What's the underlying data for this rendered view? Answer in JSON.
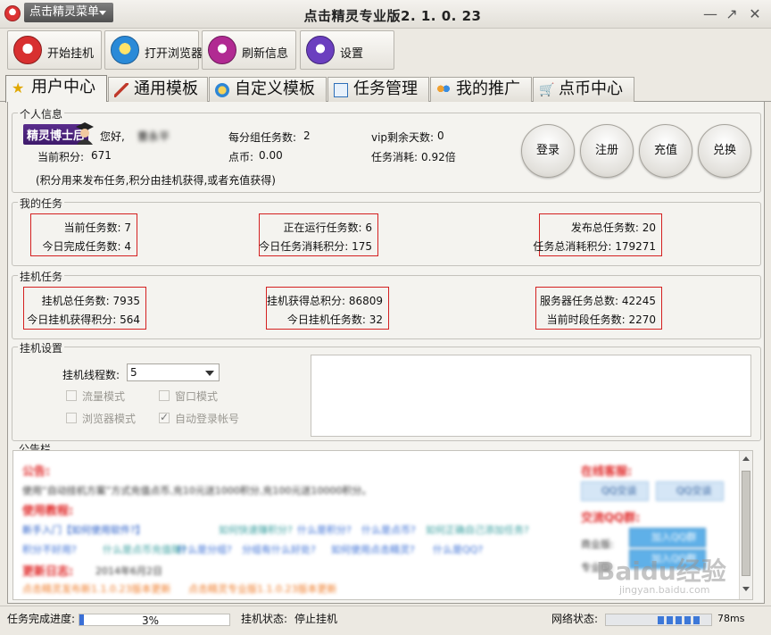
{
  "titlebar": {
    "menu_button": "点击精灵菜单",
    "title": "点击精灵专业版2. 1. 0. 23",
    "minimize": "—",
    "restore": "↗",
    "close": "✕"
  },
  "toolbar": {
    "buttons": [
      {
        "label": "开始挂机",
        "icon": "start-hook-icon"
      },
      {
        "label": "打开浏览器",
        "icon": "browser-icon"
      },
      {
        "label": "刷新信息",
        "icon": "refresh-icon"
      },
      {
        "label": "设置",
        "icon": "settings-icon"
      }
    ]
  },
  "tabs": [
    {
      "label": "用户中心",
      "icon": "star-icon",
      "active": true
    },
    {
      "label": "通用模板",
      "icon": "brush-icon"
    },
    {
      "label": "自定义模板",
      "icon": "globe-icon"
    },
    {
      "label": "任务管理",
      "icon": "task-icon"
    },
    {
      "label": "我的推广",
      "icon": "people-icon"
    },
    {
      "label": "点币中心",
      "icon": "cart-icon"
    }
  ],
  "user_info": {
    "group_title": "个人信息",
    "badge": "精灵博士后",
    "greeting": "您好,",
    "username": "曹永平",
    "tasks_per_group_label": "每分组任务数:",
    "tasks_per_group": "2",
    "vip_days_label": "vip剩余天数:",
    "vip_days": "0",
    "points_label": "当前积分:",
    "points": "671",
    "coins_label": "点币:",
    "coins": "0.00",
    "task_cost_label": "任务消耗:",
    "task_cost": "0.92倍",
    "note": "(积分用来发布任务,积分由挂机获得,或者充值获得)",
    "buttons": [
      "登录",
      "注册",
      "充值",
      "兑换"
    ]
  },
  "my_tasks": {
    "group_title": "我的任务",
    "current_tasks_label": "当前任务数:",
    "current_tasks": "7",
    "today_completed_label": "今日完成任务数:",
    "today_completed": "4",
    "running_tasks_label": "正在运行任务数:",
    "running_tasks": "6",
    "today_points_used_label": "今日任务消耗积分:",
    "today_points_used": "175",
    "published_total_label": "发布总任务数:",
    "published_total": "20",
    "total_points_used_label": "任务总消耗积分:",
    "total_points_used": "179271"
  },
  "hook_tasks": {
    "group_title": "挂机任务",
    "total_tasks_label": "挂机总任务数:",
    "total_tasks": "7935",
    "today_points_label": "今日挂机获得积分:",
    "today_points": "564",
    "total_points_label": "挂机获得总积分:",
    "total_points": "86809",
    "today_tasks_label": "今日挂机任务数:",
    "today_tasks": "32",
    "server_total_label": "服务器任务总数:",
    "server_total": "42245",
    "current_period_label": "当前时段任务数:",
    "current_period": "2270"
  },
  "hook_settings": {
    "group_title": "挂机设置",
    "threads_label": "挂机线程数:",
    "threads_value": "5",
    "flow_mode": "流量模式",
    "window_mode": "窗口模式",
    "browser_mode": "浏览器模式",
    "auto_login": "自动登录帐号"
  },
  "notice": {
    "group_title": "公告栏",
    "announce_title": "公告:",
    "announce_text": "使用“自动挂机方案”方式充值点币,充10元送1000积分,充100元送10000积分。",
    "tutorial_title": "使用教程:",
    "tutorial_links_1": [
      "新手入门【如何使用软件?】",
      "如何快速赚积分?",
      "什么是积分?",
      "什么是点币?",
      "如何正确自己添加任务?"
    ],
    "tutorial_links_2": [
      "积分不好用?",
      "什么是点币充值赚?",
      "什么是分组?",
      "分组有什么好处?",
      "如何使用点击精灵?",
      "什么是QQ?"
    ],
    "changelog_title": "更新日志:",
    "changelog_date": "2014年6月2日",
    "changelog_links": [
      "点击精灵发布新1.1.0.23版本更新",
      "点击精灵专业版1.1.0.23版本更新"
    ],
    "online_service_title": "在线客服:",
    "qq_buttons": [
      "QQ交谈",
      "QQ交谈"
    ],
    "group_title_2": "交流QQ群:",
    "group_rows": [
      {
        "label": "商业版:",
        "button": "加入QQ群"
      },
      {
        "label": "专业版:",
        "button": "加入QQ群"
      }
    ]
  },
  "statusbar": {
    "progress_label": "任务完成进度:",
    "progress_value": "3%",
    "progress_fraction": 0.03,
    "hook_status_label": "挂机状态:",
    "hook_status": "停止挂机",
    "network_label": "网络状态:",
    "network_latency": "78ms",
    "network_segments": 5
  },
  "watermark": {
    "text": "Baidu经验",
    "sub": "jingyan.baidu.com"
  },
  "colors": {
    "red_border": "#d42020",
    "notice_red": "#e02a2a",
    "link_blue": "#1f57c6",
    "badge_purple": "#4a2378"
  }
}
